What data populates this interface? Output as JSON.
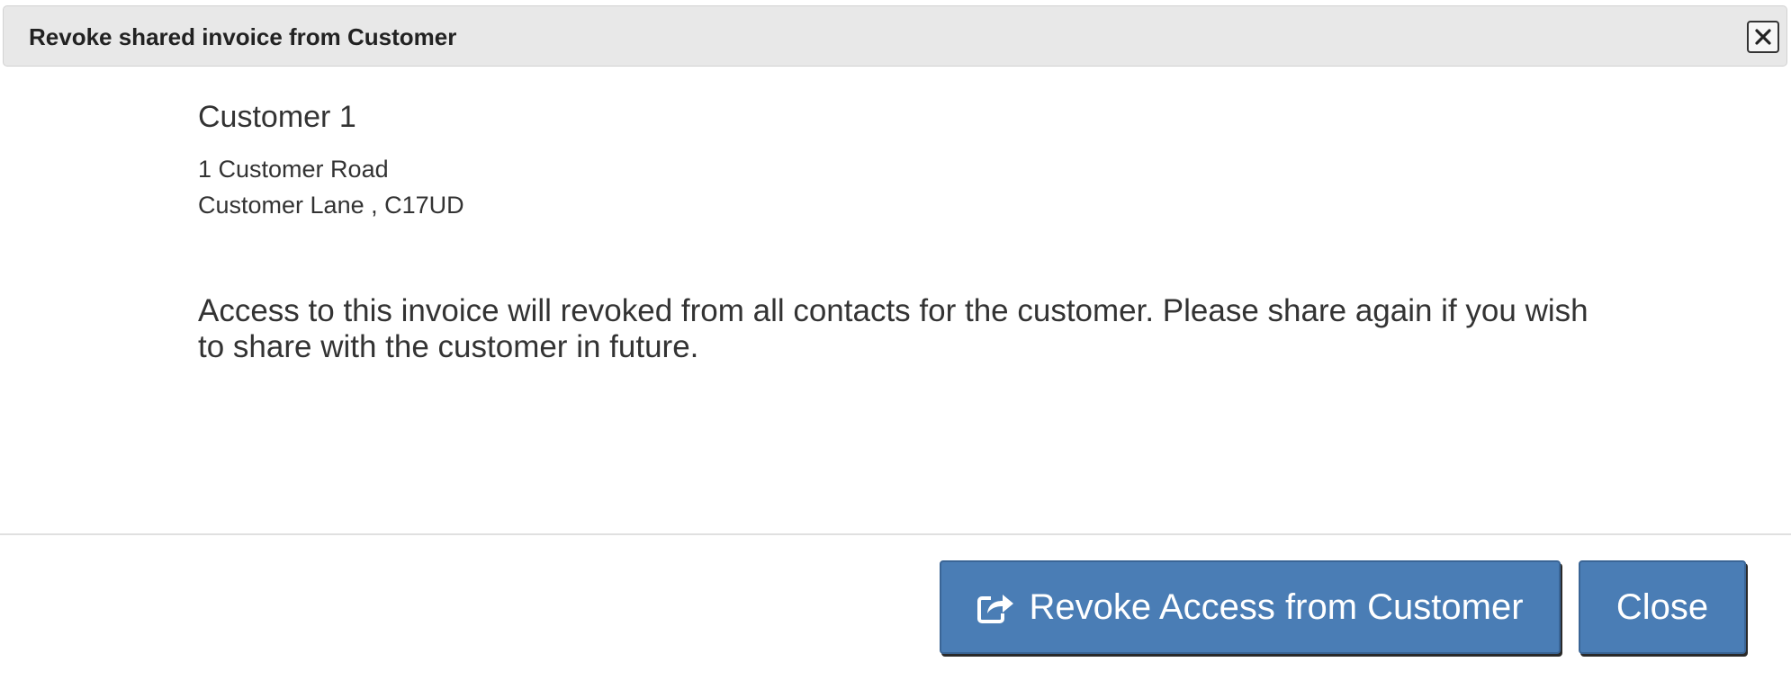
{
  "dialog": {
    "title": "Revoke shared invoice from Customer",
    "close_icon": "close-x-icon"
  },
  "customer": {
    "name": "Customer 1",
    "address_line1": "1 Customer Road",
    "address_line2": "Customer Lane , C17UD"
  },
  "message": "Access to this invoice will revoked from all contacts for the customer. Please share again if you wish to share with the customer in future.",
  "footer": {
    "revoke_label": "Revoke Access from Customer",
    "revoke_icon": "share-square-icon",
    "close_label": "Close"
  },
  "colors": {
    "button_primary": "#4a7db5",
    "titlebar_bg": "#e8e8e8"
  }
}
